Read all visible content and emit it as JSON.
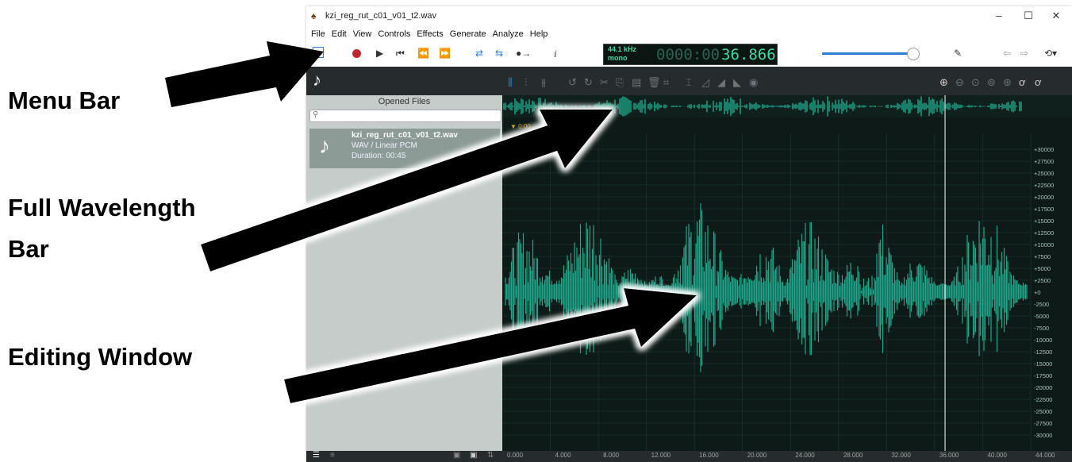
{
  "annotations": {
    "menu_bar": "Menu Bar",
    "full_wavelength_bar_1": "Full Wavelength",
    "full_wavelength_bar_2": "Bar",
    "editing_window": "Editing Window"
  },
  "window": {
    "title": "kzi_reg_rut_c01_v01_t2.wav",
    "minimize": "–",
    "maximize": "☐",
    "close": "✕"
  },
  "menu": [
    "File",
    "Edit",
    "View",
    "Controls",
    "Effects",
    "Generate",
    "Analyze",
    "Help"
  ],
  "toolbar": {
    "info_label": "i",
    "lcd_rate": "44.1 kHz",
    "lcd_channels": "mono",
    "lcd_time_dim": "0000:00",
    "lcd_time": "36.866"
  },
  "files_panel": {
    "header": "Opened Files",
    "search_placeholder": "",
    "file_name": "kzi_reg_rut_c01_v01_t2.wav",
    "file_format": "WAV / Linear PCM",
    "file_duration": "Duration: 00:45"
  },
  "overview": {
    "marker_label": "0:00"
  },
  "amplitude_labels": [
    "+30000",
    "+27500",
    "+25000",
    "+22500",
    "+20000",
    "+17500",
    "+15000",
    "+12500",
    "+10000",
    "+7500",
    "+5000",
    "+2500",
    "+0",
    "-2500",
    "-5000",
    "-7500",
    "-10000",
    "-12500",
    "-15000",
    "-17500",
    "-20000",
    "-22500",
    "-25000",
    "-27500",
    "-30000"
  ],
  "time_labels": [
    "0.000",
    "4.000",
    "8.000",
    "12.000",
    "16.000",
    "20.000",
    "24.000",
    "28.000",
    "32.000",
    "36.000",
    "40.000",
    "44.000"
  ],
  "colors": {
    "waveform": "#1fa68a",
    "background": "#0e1a17",
    "panel": "#c5ccc9",
    "dark_bar": "#262b2e",
    "lcd_text": "#3dd9a8",
    "record": "#c0282d",
    "loop": "#2a7fd4"
  }
}
